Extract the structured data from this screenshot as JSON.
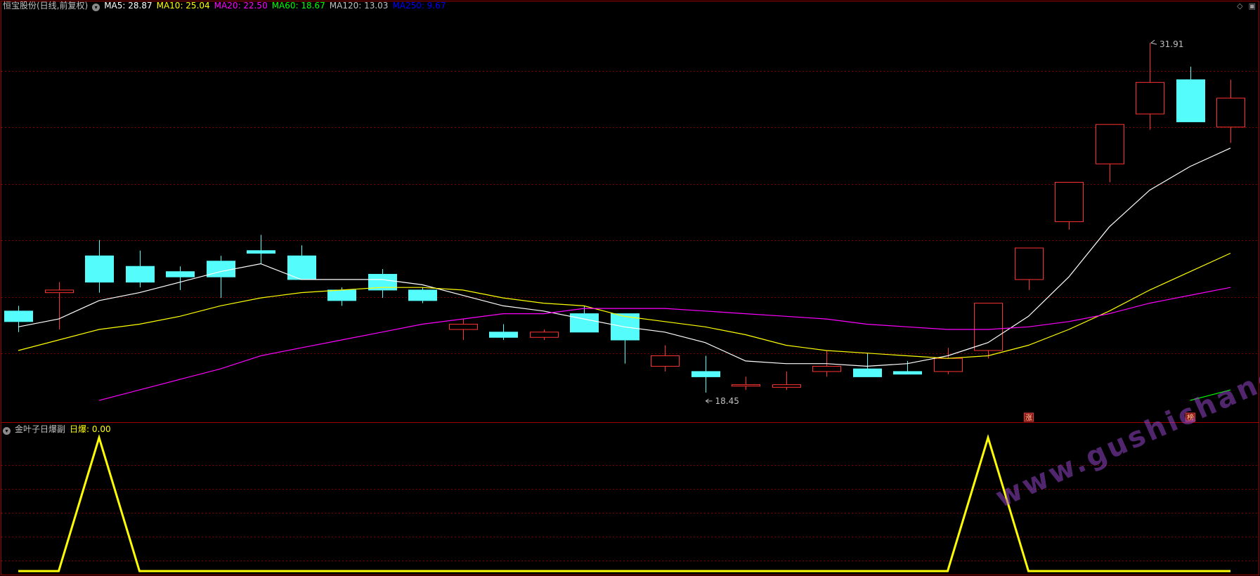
{
  "main": {
    "stock_title": "恒宝股份(日线,前复权)",
    "ma_legend": [
      {
        "label": "MA5: 28.87",
        "color": "#ffffff"
      },
      {
        "label": "MA10: 25.04",
        "color": "#ffff00"
      },
      {
        "label": "MA20: 22.50",
        "color": "#ff00ff"
      },
      {
        "label": "MA60: 18.67",
        "color": "#00ff00"
      },
      {
        "label": "MA120: 13.03",
        "color": "#c0c0c0"
      },
      {
        "label": "MA250: 9.67",
        "color": "#0000ff"
      }
    ],
    "high_label": "31.91",
    "low_label": "18.45",
    "badge_zhang": "涨",
    "badge_bang": "榜"
  },
  "sub": {
    "indicator_name": "金叶子日爆副",
    "value_label": "日爆: 0.00",
    "value_color": "#ffff00"
  },
  "watermark": "www.gushichanghong.com",
  "colors": {
    "up": "#ff3333",
    "down": "#54fcfc",
    "grid": "#800000",
    "frame": "#a00000"
  },
  "chart_data": [
    {
      "type": "candlestick",
      "title": "恒宝股份(日线,前复权)",
      "ylim": [
        17.5,
        33
      ],
      "annotations": [
        {
          "text": "31.91",
          "target": "max high"
        },
        {
          "text": "18.45",
          "target": "min low"
        }
      ],
      "candles": [
        {
          "o": 21.7,
          "h": 21.9,
          "l": 20.9,
          "c": 21.3
        },
        {
          "o": 22.4,
          "h": 22.8,
          "l": 21.0,
          "c": 22.5
        },
        {
          "o": 23.8,
          "h": 24.4,
          "l": 22.4,
          "c": 22.8
        },
        {
          "o": 23.4,
          "h": 24.0,
          "l": 22.6,
          "c": 22.8
        },
        {
          "o": 23.2,
          "h": 23.4,
          "l": 22.5,
          "c": 23.0
        },
        {
          "o": 23.6,
          "h": 23.8,
          "l": 22.2,
          "c": 23.0
        },
        {
          "o": 24.0,
          "h": 24.6,
          "l": 23.5,
          "c": 23.9
        },
        {
          "o": 23.8,
          "h": 24.2,
          "l": 23.0,
          "c": 22.9
        },
        {
          "o": 22.5,
          "h": 22.6,
          "l": 21.9,
          "c": 22.1
        },
        {
          "o": 23.1,
          "h": 23.3,
          "l": 22.2,
          "c": 22.5
        },
        {
          "o": 22.5,
          "h": 22.6,
          "l": 22.0,
          "c": 22.1
        },
        {
          "o": 21.0,
          "h": 21.4,
          "l": 20.6,
          "c": 21.2
        },
        {
          "o": 20.9,
          "h": 21.2,
          "l": 20.6,
          "c": 20.7
        },
        {
          "o": 20.7,
          "h": 21.0,
          "l": 20.6,
          "c": 20.9
        },
        {
          "o": 21.6,
          "h": 21.9,
          "l": 20.9,
          "c": 20.9
        },
        {
          "o": 21.6,
          "h": 21.6,
          "l": 19.7,
          "c": 20.6
        },
        {
          "o": 19.6,
          "h": 20.4,
          "l": 19.4,
          "c": 20.0
        },
        {
          "o": 19.4,
          "h": 20.0,
          "l": 18.6,
          "c": 19.2
        },
        {
          "o": 18.9,
          "h": 19.2,
          "l": 18.7,
          "c": 18.9
        },
        {
          "o": 18.8,
          "h": 19.4,
          "l": 18.7,
          "c": 18.9
        },
        {
          "o": 19.4,
          "h": 20.2,
          "l": 19.2,
          "c": 19.6
        },
        {
          "o": 19.5,
          "h": 20.1,
          "l": 19.3,
          "c": 19.2
        },
        {
          "o": 19.4,
          "h": 19.8,
          "l": 19.3,
          "c": 19.3
        },
        {
          "o": 19.4,
          "h": 20.3,
          "l": 19.3,
          "c": 19.9
        },
        {
          "o": 20.2,
          "h": 20.9,
          "l": 19.9,
          "c": 22.0
        },
        {
          "o": 22.9,
          "h": 22.9,
          "l": 22.5,
          "c": 24.1
        },
        {
          "o": 25.1,
          "h": 25.1,
          "l": 24.8,
          "c": 26.6
        },
        {
          "o": 27.3,
          "h": 27.9,
          "l": 26.6,
          "c": 28.8
        },
        {
          "o": 29.2,
          "h": 31.9,
          "l": 28.6,
          "c": 30.4
        },
        {
          "o": 30.5,
          "h": 31.0,
          "l": 28.9,
          "c": 28.9
        },
        {
          "o": 28.7,
          "h": 30.5,
          "l": 28.1,
          "c": 29.8
        }
      ],
      "series": [
        {
          "name": "MA5",
          "color": "#ffffff",
          "values": [
            21.1,
            21.4,
            22.1,
            22.4,
            22.8,
            23.2,
            23.5,
            22.9,
            22.9,
            22.9,
            22.7,
            22.3,
            21.9,
            21.7,
            21.4,
            21.1,
            20.9,
            20.5,
            19.8,
            19.7,
            19.7,
            19.6,
            19.7,
            20.0,
            20.5,
            21.5,
            23.0,
            24.9,
            26.3,
            27.2,
            27.9
          ]
        },
        {
          "name": "MA10",
          "color": "#ffff00",
          "values": [
            20.2,
            20.6,
            21.0,
            21.2,
            21.5,
            21.9,
            22.2,
            22.4,
            22.5,
            22.6,
            22.6,
            22.5,
            22.2,
            22.0,
            21.9,
            21.5,
            21.3,
            21.1,
            20.8,
            20.4,
            20.2,
            20.1,
            20.0,
            19.9,
            20.0,
            20.4,
            21.0,
            21.7,
            22.5,
            23.2,
            23.9
          ]
        },
        {
          "name": "MA20",
          "color": "#ff00ff",
          "values": [
            null,
            null,
            18.3,
            18.7,
            19.1,
            19.5,
            20.0,
            20.3,
            20.6,
            20.9,
            21.2,
            21.4,
            21.6,
            21.6,
            21.8,
            21.8,
            21.8,
            21.7,
            21.6,
            21.5,
            21.4,
            21.2,
            21.1,
            21.0,
            21.0,
            21.1,
            21.3,
            21.6,
            22.0,
            22.3,
            22.6
          ]
        },
        {
          "name": "MA60",
          "color": "#00ff00",
          "values": [
            null,
            null,
            null,
            null,
            null,
            null,
            null,
            null,
            null,
            null,
            null,
            null,
            null,
            null,
            null,
            null,
            null,
            null,
            null,
            null,
            null,
            null,
            null,
            null,
            null,
            null,
            null,
            null,
            null,
            18.3,
            18.7
          ]
        }
      ]
    },
    {
      "type": "line",
      "title": "金叶子日爆副",
      "ylim": [
        0,
        1
      ],
      "series": [
        {
          "name": "日爆",
          "color": "#ffff00",
          "values": [
            0,
            0,
            1,
            0,
            0,
            0,
            0,
            0,
            0,
            0,
            0,
            0,
            0,
            0,
            0,
            0,
            0,
            0,
            0,
            0,
            0,
            0,
            0,
            0,
            1,
            0,
            0,
            0,
            0,
            0,
            0
          ]
        }
      ]
    }
  ]
}
